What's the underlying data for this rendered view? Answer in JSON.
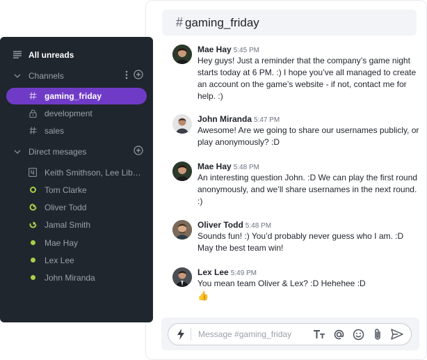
{
  "channel": {
    "name": "gaming_friday",
    "hash": "#"
  },
  "messages": [
    {
      "author": "Mae Hay",
      "time": "5:45 PM",
      "text": "Hey guys! Just a reminder that the company’s game night starts today at 6 PM. :) I hope you’ve all managed to create an account on the game’s website - if not, contact me for help. :)"
    },
    {
      "author": "John Miranda",
      "time": "5:47 PM",
      "text": "Awesome! Are we going to share our usernames publicly, or play anonymously? :D"
    },
    {
      "author": "Mae Hay",
      "time": "5:48 PM",
      "text": "An interesting question John. :D We can play the first round anonymously, and we’ll share usernames in the next round. :)"
    },
    {
      "author": "Oliver Todd",
      "time": "5:48 PM",
      "text": "Sounds fun! :) You’d probably never guess who I am. :D May the best team win!"
    },
    {
      "author": "Lex Lee",
      "time": "5:49 PM",
      "text": "You mean team Oliver & Lex? :D Hehehee :D",
      "emoji": "👍"
    }
  ],
  "composer": {
    "placeholder": "Message #gaming_friday"
  },
  "sidebar": {
    "all_unreads": "All unreads",
    "channels_label": "Channels",
    "channels": [
      {
        "name": "gaming_friday",
        "icon": "hash-icon"
      },
      {
        "name": "development",
        "icon": "lock-icon"
      },
      {
        "name": "sales",
        "icon": "hash-icon"
      }
    ],
    "dm_label": "Direct mesages",
    "direct_messages": [
      {
        "name": "Keith Smithson, Lee Libe...",
        "icon": "group-4-icon"
      },
      {
        "name": "Tom Clarke",
        "icon": "status-ring-icon"
      },
      {
        "name": "Oliver Todd",
        "icon": "status-partial-icon"
      },
      {
        "name": "Jamal Smith",
        "icon": "status-partial-icon"
      },
      {
        "name": "Mae Hay",
        "icon": "status-online-icon"
      },
      {
        "name": "Lex Lee",
        "icon": "status-online-icon"
      },
      {
        "name": "John Miranda",
        "icon": "status-online-icon"
      }
    ]
  },
  "colors": {
    "accent": "#6f3bc6",
    "sidebar_bg": "#20262d",
    "online": "#a8d04a"
  }
}
